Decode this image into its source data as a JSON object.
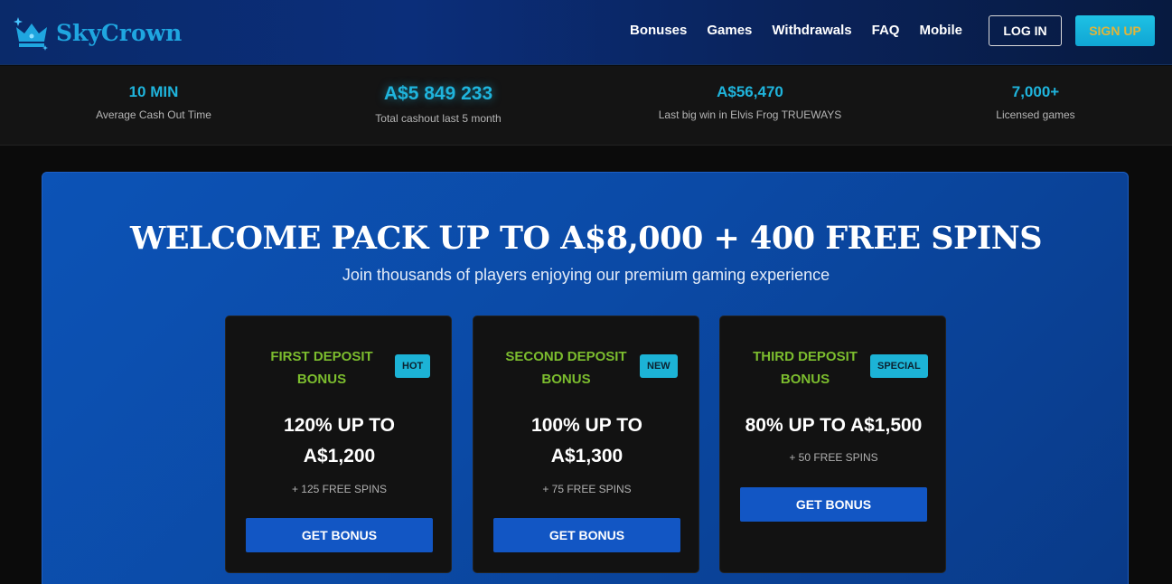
{
  "header": {
    "logo_text": "SkyCrown",
    "nav": [
      "Bonuses",
      "Games",
      "Withdrawals",
      "FAQ",
      "Mobile"
    ],
    "login_label": "LOG IN",
    "signup_label": "SIGN UP"
  },
  "stats": [
    {
      "value": "10 MIN",
      "label": "Average Cash Out Time"
    },
    {
      "value": "A$5 849 233",
      "label": "Total cashout last 5 month"
    },
    {
      "value": "A$56,470",
      "label": "Last big win in Elvis Frog TRUEWAYS"
    },
    {
      "value": "7,000+",
      "label": "Licensed games"
    }
  ],
  "hero": {
    "title": "WELCOME PACK UP TO A$8,000 + 400 FREE SPINS",
    "subtitle": "Join thousands of players enjoying our premium gaming experience"
  },
  "cards": [
    {
      "title": "FIRST DEPOSIT BONUS",
      "badge": "HOT",
      "amount": "120% UP TO A$1,200",
      "spins": "+ 125 FREE SPINS",
      "button": "GET BONUS"
    },
    {
      "title": "SECOND DEPOSIT BONUS",
      "badge": "NEW",
      "amount": "100% UP TO A$1,300",
      "spins": "+ 75 FREE SPINS",
      "button": "GET BONUS"
    },
    {
      "title": "THIRD DEPOSIT BONUS",
      "badge": "SPECIAL",
      "amount": "80% UP TO A$1,500",
      "spins": "+ 50 FREE SPINS",
      "button": "GET BONUS"
    }
  ],
  "colors": {
    "accent": "#1fb4dc",
    "card_title": "#7cbd2e",
    "button": "#1256c4",
    "hero": "#0c53b6"
  },
  "icons": {
    "logo": "crown-icon"
  }
}
